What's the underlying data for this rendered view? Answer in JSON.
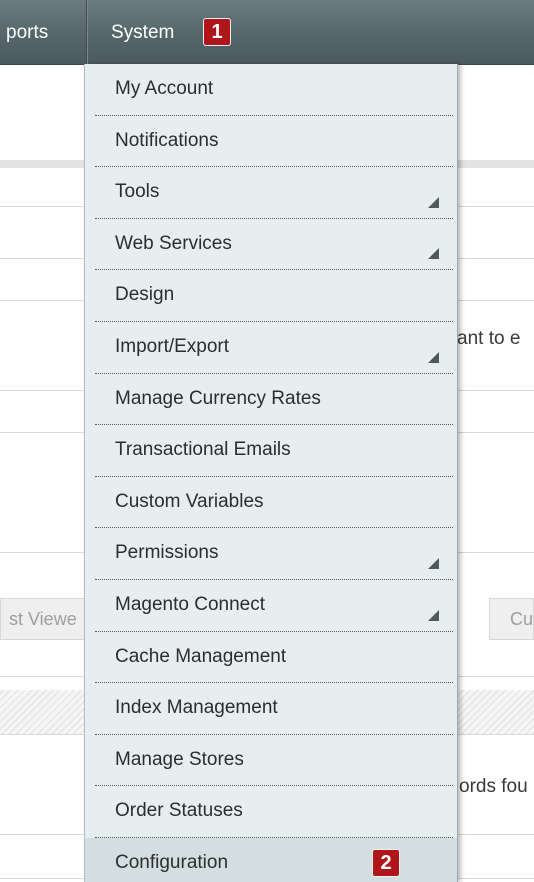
{
  "nav": {
    "reports_label": "ports",
    "system_label": "System",
    "callout_1": "1"
  },
  "background": {
    "partial_text_1": "ant to e",
    "partial_text_2": "ords fou",
    "tab_1": "st Viewe",
    "tab_2": "Cu"
  },
  "menu": {
    "items": [
      {
        "label": "My Account",
        "has_submenu": false
      },
      {
        "label": "Notifications",
        "has_submenu": false
      },
      {
        "label": "Tools",
        "has_submenu": true
      },
      {
        "label": "Web Services",
        "has_submenu": true
      },
      {
        "label": "Design",
        "has_submenu": false
      },
      {
        "label": "Import/Export",
        "has_submenu": true
      },
      {
        "label": "Manage Currency Rates",
        "has_submenu": false
      },
      {
        "label": "Transactional Emails",
        "has_submenu": false
      },
      {
        "label": "Custom Variables",
        "has_submenu": false
      },
      {
        "label": "Permissions",
        "has_submenu": true
      },
      {
        "label": "Magento Connect",
        "has_submenu": true
      },
      {
        "label": "Cache Management",
        "has_submenu": false
      },
      {
        "label": "Index Management",
        "has_submenu": false
      },
      {
        "label": "Manage Stores",
        "has_submenu": false
      },
      {
        "label": "Order Statuses",
        "has_submenu": false
      },
      {
        "label": "Configuration",
        "has_submenu": false,
        "highlighted": true
      }
    ],
    "callout_2": "2"
  },
  "colors": {
    "nav_bg": "#55656a",
    "menu_bg": "#e7eef0",
    "menu_active_bg": "#d2dee0",
    "callout_bg": "#b0151b"
  }
}
